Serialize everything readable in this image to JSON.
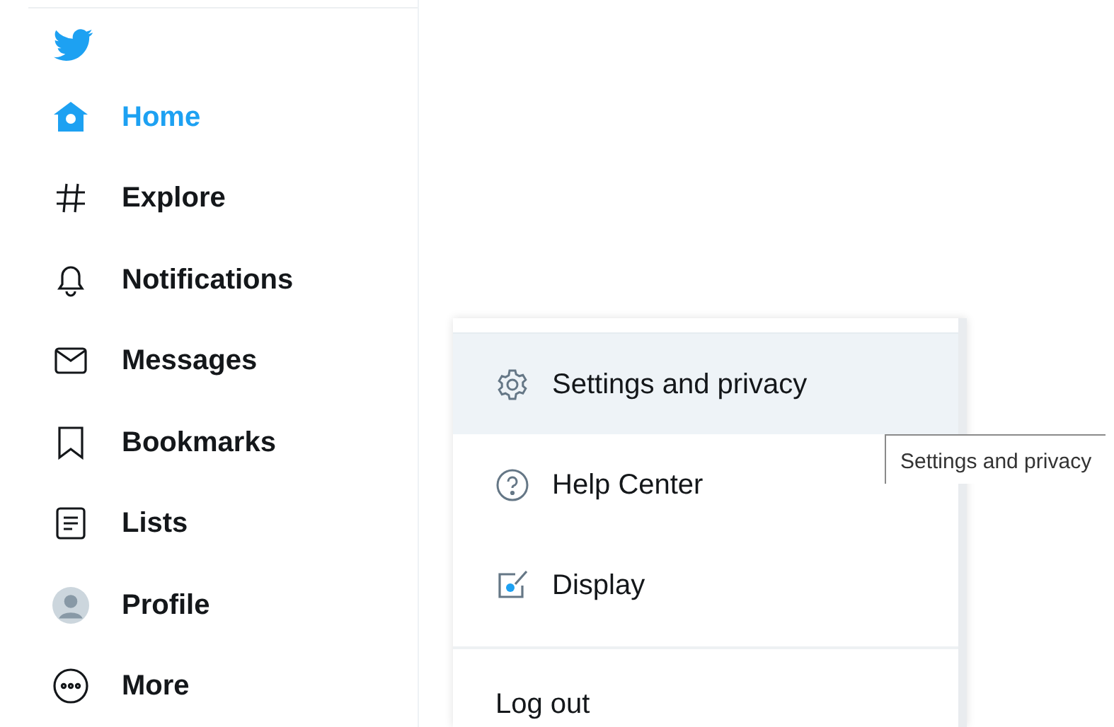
{
  "nav": [
    {
      "label": "Home",
      "selected": true
    },
    {
      "label": "Explore",
      "selected": false
    },
    {
      "label": "Notifications",
      "selected": false
    },
    {
      "label": "Messages",
      "selected": false
    },
    {
      "label": "Bookmarks",
      "selected": false
    },
    {
      "label": "Lists",
      "selected": false
    },
    {
      "label": "Profile",
      "selected": false
    },
    {
      "label": "More",
      "selected": false
    }
  ],
  "menu": {
    "items": [
      {
        "label": "Settings and privacy",
        "selected": true
      },
      {
        "label": "Help Center",
        "selected": false
      },
      {
        "label": "Display",
        "selected": false
      }
    ],
    "logout": "Log out"
  },
  "tooltip": "Settings and privacy"
}
